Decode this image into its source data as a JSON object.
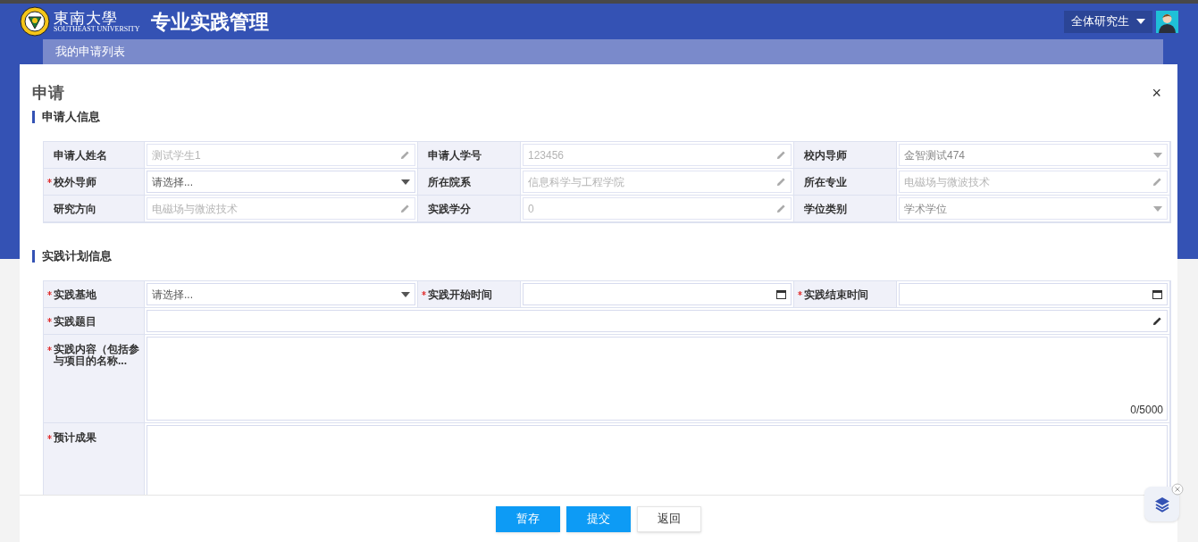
{
  "header": {
    "logo_text": "東南大學",
    "logo_subtext": "SOUTHEAST UNIVERSITY",
    "title": "专业实践管理",
    "role": "全体研究生"
  },
  "tabs": [
    {
      "label": "我的申请列表",
      "selected": true
    }
  ],
  "dialog": {
    "title": "申请",
    "close": "×",
    "sections": [
      {
        "title": "申请人信息",
        "rows": [
          [
            {
              "label": "申请人姓名",
              "required": false,
              "kind": "text",
              "value": "测试学生1",
              "disabled": true
            },
            {
              "label": "申请人学号",
              "required": false,
              "kind": "text",
              "value": "123456",
              "disabled": true
            },
            {
              "label": "校内导师",
              "required": false,
              "kind": "select",
              "value": "金智测试474",
              "disabled": true
            }
          ],
          [
            {
              "label": "校外导师",
              "required": true,
              "kind": "select",
              "placeholder": "请选择...",
              "disabled": false
            },
            {
              "label": "所在院系",
              "required": false,
              "kind": "text",
              "value": "信息科学与工程学院",
              "disabled": true
            },
            {
              "label": "所在专业",
              "required": false,
              "kind": "text",
              "value": "电磁场与微波技术",
              "disabled": true
            }
          ],
          [
            {
              "label": "研究方向",
              "required": false,
              "kind": "text",
              "value": "电磁场与微波技术",
              "disabled": true
            },
            {
              "label": "实践学分",
              "required": false,
              "kind": "text",
              "value": "0",
              "disabled": true
            },
            {
              "label": "学位类别",
              "required": false,
              "kind": "select",
              "value": "学术学位",
              "disabled": true
            }
          ]
        ]
      },
      {
        "title": "实践计划信息",
        "rows": [
          [
            {
              "label": "实践基地",
              "required": true,
              "kind": "select",
              "placeholder": "请选择...",
              "disabled": false
            },
            {
              "label": "实践开始时间",
              "required": true,
              "kind": "date",
              "disabled": false
            },
            {
              "label": "实践结束时间",
              "required": true,
              "kind": "date",
              "disabled": false
            }
          ],
          [
            {
              "label": "实践题目",
              "required": true,
              "kind": "text",
              "disabled": false
            }
          ],
          [
            {
              "label": "实践内容（包括参与项目的名称...",
              "required": true,
              "kind": "textarea",
              "counter": "0/5000"
            }
          ],
          [
            {
              "label": "预计成果",
              "required": true,
              "kind": "textarea"
            }
          ]
        ]
      }
    ],
    "buttons": [
      {
        "label": "暂存",
        "kind": "primary"
      },
      {
        "label": "提交",
        "kind": "primary"
      },
      {
        "label": "返回",
        "kind": "default"
      }
    ]
  }
}
